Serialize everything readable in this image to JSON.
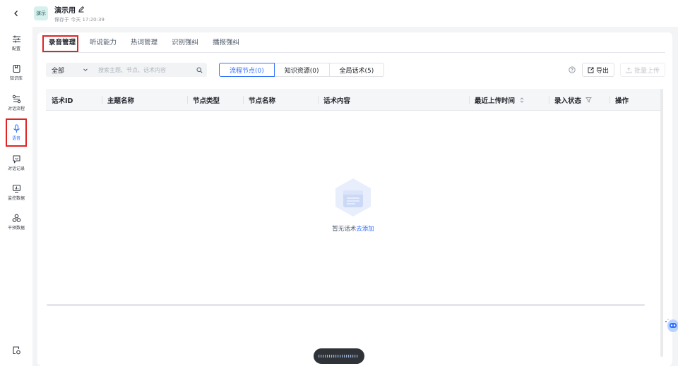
{
  "header": {
    "back_icon": "chevron-left-icon",
    "app_badge": "演示",
    "title": "演示用",
    "edit_icon": "pencil-icon",
    "saved_text": "保存于 今天 17:20:39"
  },
  "sidebar": {
    "items": [
      {
        "label": "配置",
        "icon": "sliders-icon"
      },
      {
        "label": "知识库",
        "icon": "book-icon"
      },
      {
        "label": "对话流程",
        "icon": "flow-icon"
      },
      {
        "label": "语音",
        "icon": "microphone-icon"
      },
      {
        "label": "对话记录",
        "icon": "chat-icon"
      },
      {
        "label": "监控数据",
        "icon": "monitor-chart-icon"
      },
      {
        "label": "干预数据",
        "icon": "circles-icon"
      }
    ],
    "active_index": 3,
    "bottom_icon": "settings-doc-icon"
  },
  "tabs": [
    {
      "label": "录音管理"
    },
    {
      "label": "听说能力"
    },
    {
      "label": "热词管理"
    },
    {
      "label": "识别强纠"
    },
    {
      "label": "播报强纠"
    }
  ],
  "active_tab": 0,
  "toolbar": {
    "select_value": "全部",
    "search_placeholder": "搜索主题、节点、话术内容",
    "segments": [
      {
        "label": "流程节点(0)"
      },
      {
        "label": "知识资源(0)"
      },
      {
        "label": "全局话术(5)"
      }
    ],
    "active_segment": 0,
    "export_label": "导出",
    "batch_upload_label": "批量上传"
  },
  "table": {
    "columns": [
      "话术ID",
      "主题名称",
      "节点类型",
      "节点名称",
      "话术内容",
      "最近上传时间",
      "录入状态",
      "操作"
    ],
    "rows": []
  },
  "empty_state": {
    "text": "暂无话术",
    "link": "去添加"
  },
  "colors": {
    "accent": "#3370ff",
    "highlight_box": "#e02424"
  }
}
